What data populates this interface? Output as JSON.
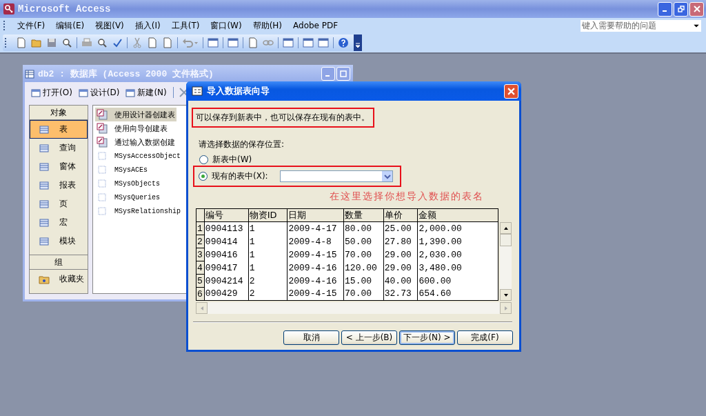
{
  "app_window": {
    "title": "Microsoft Access"
  },
  "menu_bar": [
    "文件(F)",
    "编辑(E)",
    "视图(V)",
    "插入(I)",
    "工具(T)",
    "窗口(W)",
    "帮助(H)",
    "Adobe PDF"
  ],
  "help_box": {
    "placeholder": "键入需要帮助的问题"
  },
  "database_window": {
    "title": "db2 : 数据库 (Access 2000 文件格式)",
    "toolbar": [
      {
        "label": "打开(O)"
      },
      {
        "label": "设计(D)"
      },
      {
        "label": "新建(N)"
      }
    ],
    "objects_header": "对象",
    "objects": [
      {
        "label": "表",
        "selected": true
      },
      {
        "label": "查询",
        "selected": false
      },
      {
        "label": "窗体",
        "selected": false
      },
      {
        "label": "报表",
        "selected": false
      },
      {
        "label": "页",
        "selected": false
      },
      {
        "label": "宏",
        "selected": false
      },
      {
        "label": "模块",
        "selected": false
      }
    ],
    "groups_header": "组",
    "groups": [
      {
        "label": "收藏夹",
        "selected": false
      }
    ],
    "items": [
      {
        "label": "使用设计器创建表",
        "kind": "shortcut",
        "selected": true
      },
      {
        "label": "使用向导创建表",
        "kind": "shortcut",
        "selected": false
      },
      {
        "label": "通过输入数据创建",
        "kind": "shortcut",
        "selected": false
      },
      {
        "label": "MSysAccessObject",
        "kind": "table",
        "selected": false
      },
      {
        "label": "MSysACEs",
        "kind": "table",
        "selected": false
      },
      {
        "label": "MSysObjects",
        "kind": "table",
        "selected": false
      },
      {
        "label": "MSysQueries",
        "kind": "table",
        "selected": false
      },
      {
        "label": "MSysRelationship",
        "kind": "table",
        "selected": false
      }
    ]
  },
  "dialog": {
    "title": "导入数据表向导",
    "intro": "可以保存到新表中，也可以保存在现有的表中。",
    "prompt": "请选择数据的保存位置:",
    "options": [
      {
        "label": "新表中(W)",
        "selected": false
      },
      {
        "label": "现有的表中(X):",
        "selected": true
      }
    ],
    "annotation": "在这里选择你想导入数据的表名",
    "table": {
      "columns": [
        "编号",
        "物资ID",
        "日期",
        "数量",
        "单价",
        "金额"
      ],
      "rows": [
        {
          "number": "1",
          "cells": [
            "0904113",
            "1",
            "2009-4-17",
            "80.00",
            "25.00",
            "2,000.00"
          ]
        },
        {
          "number": "2",
          "cells": [
            "090414",
            "1",
            "2009-4-8",
            "50.00",
            "27.80",
            "1,390.00"
          ]
        },
        {
          "number": "3",
          "cells": [
            "090416",
            "1",
            "2009-4-15",
            "70.00",
            "29.00",
            "2,030.00"
          ]
        },
        {
          "number": "4",
          "cells": [
            "090417",
            "1",
            "2009-4-16",
            "120.00",
            "29.00",
            "3,480.00"
          ]
        },
        {
          "number": "5",
          "cells": [
            "0904214",
            "2",
            "2009-4-16",
            "15.00",
            "40.00",
            "600.00"
          ]
        },
        {
          "number": "6",
          "cells": [
            "090429",
            "2",
            "2009-4-15",
            "70.00",
            "32.73",
            "654.60"
          ]
        }
      ]
    },
    "buttons": [
      {
        "label": "取消",
        "default": false
      },
      {
        "label": "< 上一步(B)",
        "default": false
      },
      {
        "label": "下一步(N) >",
        "default": true
      },
      {
        "label": "完成(F)",
        "default": false
      }
    ]
  }
}
